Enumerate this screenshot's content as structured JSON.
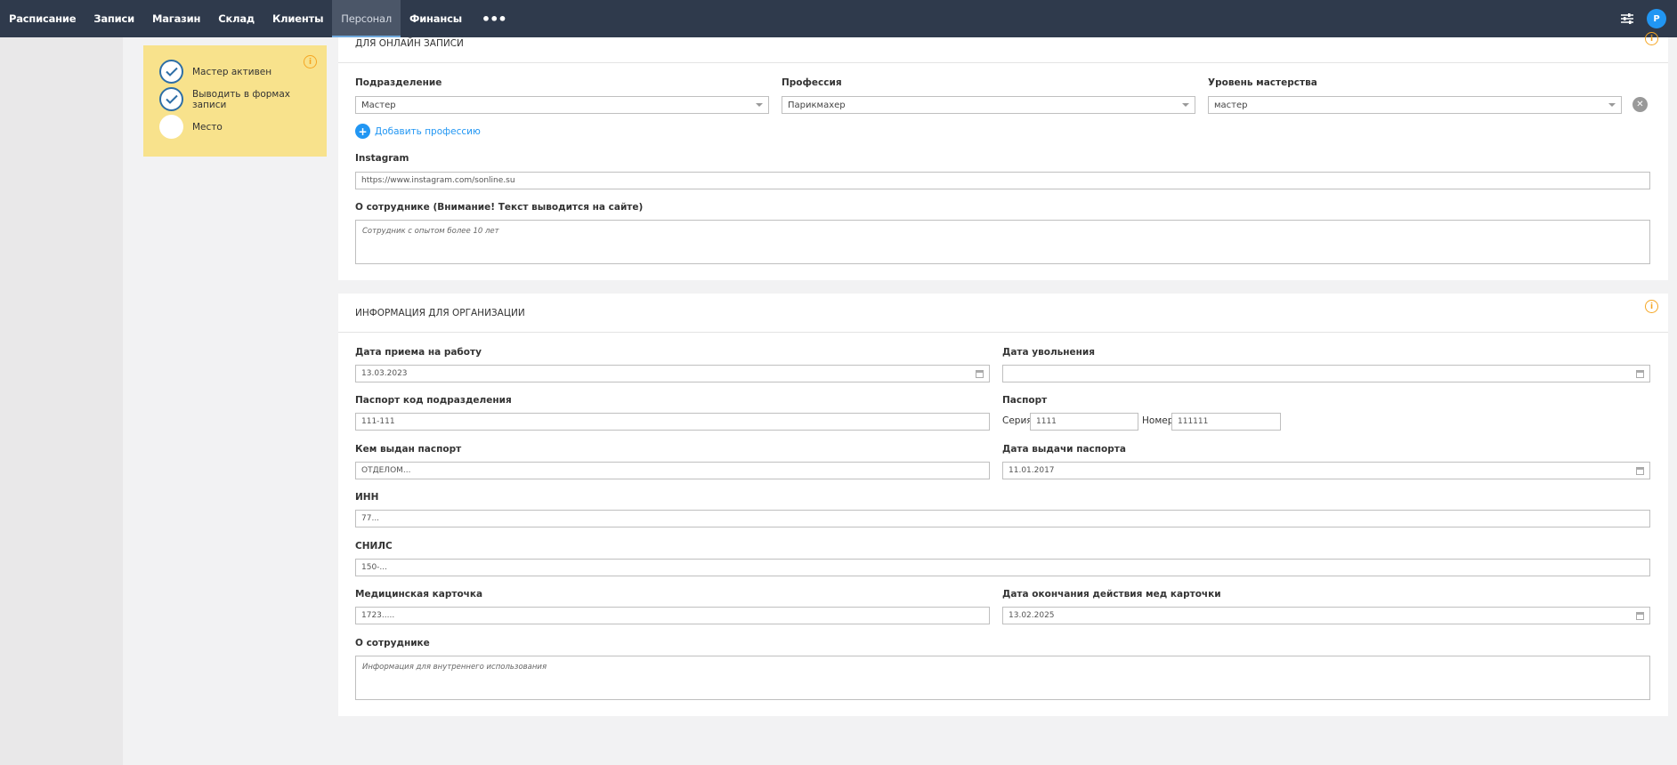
{
  "nav": {
    "items": [
      "Расписание",
      "Записи",
      "Магазин",
      "Склад",
      "Клиенты",
      "Персонал",
      "Финансы"
    ],
    "more": "•••",
    "avatar_initial": "P"
  },
  "status": {
    "active_label": "Мастер активен",
    "show_in_forms_label": "Выводить в формах записи",
    "place_label": "Место"
  },
  "online": {
    "title": "ДЛЯ ОНЛАЙН ЗАПИСИ",
    "division_label": "Подразделение",
    "division_value": "Мастер",
    "profession_label": "Профессия",
    "profession_value": "Парикмахер",
    "skill_label": "Уровень мастерства",
    "skill_value": "мастер",
    "add_profession": "Добавить профессию",
    "instagram_label": "Instagram",
    "instagram_value": "https://www.instagram.com/sonline.su",
    "about_label": "О сотруднике (Внимание! Текст выводится на сайте)",
    "about_value": "Сотрудник с опытом более 10 лет"
  },
  "org": {
    "title": "ИНФОРМАЦИЯ ДЛЯ ОРГАНИЗАЦИИ",
    "hire_date_label": "Дата приема на работу",
    "hire_date_value": "13.03.2023",
    "dismiss_date_label": "Дата увольнения",
    "dismiss_date_value": "",
    "passport_code_label": "Паспорт код подразделения",
    "passport_code_value": "111-111",
    "passport_label": "Паспорт",
    "series_label": "Серия",
    "series_value": "1111",
    "number_label": "Номер",
    "number_value": "111111",
    "issued_by_label": "Кем выдан паспорт",
    "issued_by_value": "ОТДЕЛОМ...",
    "issue_date_label": "Дата выдачи паспорта",
    "issue_date_value": "11.01.2017",
    "inn_label": "ИНН",
    "inn_value": "77...",
    "snils_label": "СНИЛС",
    "snils_value": "150-...",
    "med_card_label": "Медицинская карточка",
    "med_card_value": "1723.....",
    "med_end_label": "Дата окончания действия мед карточки",
    "med_end_value": "13.02.2025",
    "about_label": "О сотруднике",
    "about_value": "Информация для внутреннего использования"
  },
  "colors": {
    "nav_bg": "#2f3a4c",
    "accent": "#2196f3",
    "card_yellow": "#f8e28c",
    "info_orange": "#f5a623"
  }
}
